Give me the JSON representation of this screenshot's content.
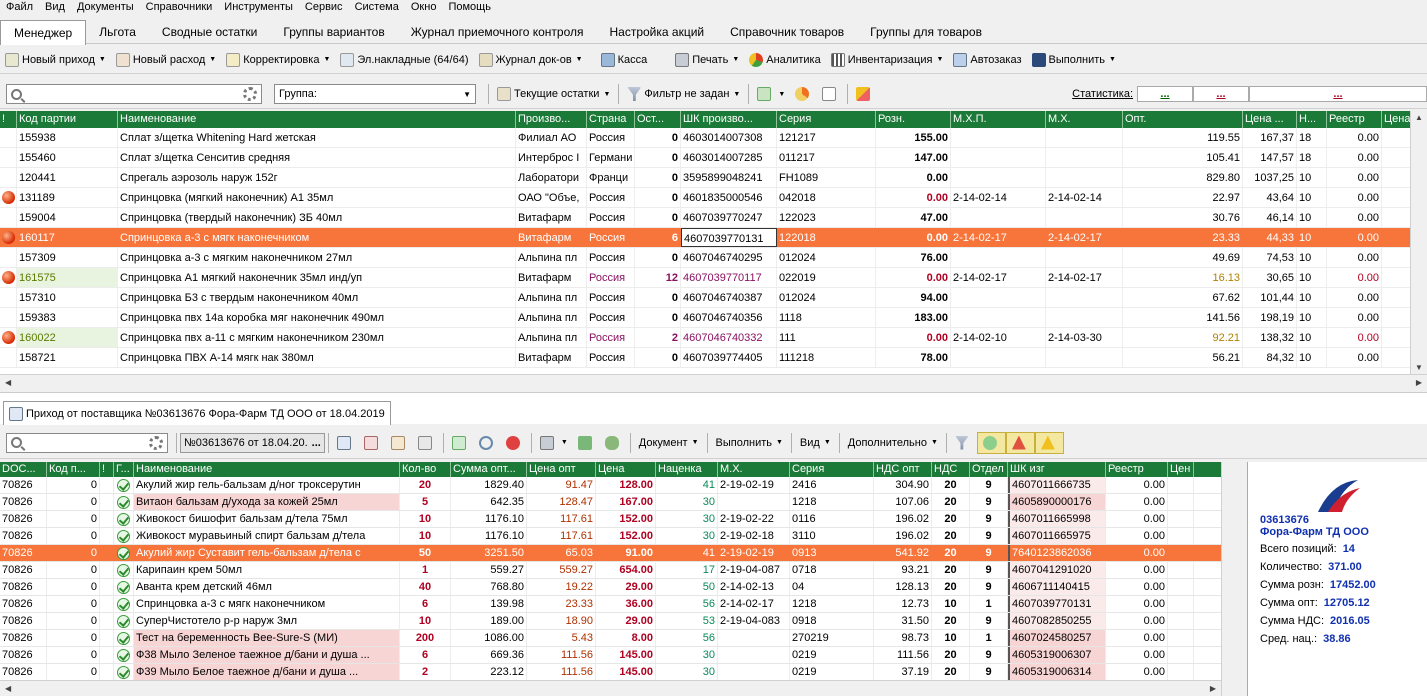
{
  "menu": [
    "Файл",
    "Вид",
    "Документы",
    "Справочники",
    "Инструменты",
    "Сервис",
    "Система",
    "Окно",
    "Помощь"
  ],
  "tabs": [
    "Менеджер",
    "Льгота",
    "Сводные остатки",
    "Группы вариантов",
    "Журнал приемочного контроля",
    "Настройка акций",
    "Справочник товаров",
    "Группы для товаров"
  ],
  "toolbar1": {
    "new_income": "Новый приход",
    "new_expense": "Новый расход",
    "correction": "Корректировка",
    "einvoices": "Эл.накладные (64/64)",
    "doc_journal": "Журнал док-ов",
    "cash": "Касса",
    "print": "Печать",
    "analytics": "Аналитика",
    "inventory": "Инвентаризация",
    "autoorder": "Автозаказ",
    "execute": "Выполнить"
  },
  "toolbar2": {
    "group_placeholder": "Группа:",
    "current_stock": "Текущие остатки",
    "filter": "Фильтр не задан",
    "stats_label": "Статистика:",
    "stat1": "...",
    "stat2": "...",
    "stat3": "..."
  },
  "top_grid": {
    "headers": [
      "!",
      "Код партии",
      "Наименование",
      "Произво...",
      "Страна",
      "Ост...",
      "ШК произво...",
      "Серия",
      "Розн.",
      "М.Х.П.",
      "М.Х.",
      "Опт.",
      "Цена ...",
      "Н...",
      "Реестр",
      "Цена изг"
    ],
    "rows": [
      {
        "flag": "",
        "code": "155938",
        "name": "Сплат з/щетка Whitening Hard жетская",
        "mfr": "Филиал АО",
        "country": "Россия",
        "stock": "0",
        "barcode": "4603014007308",
        "series": "121217",
        "retail": "155.00",
        "mhp": "",
        "mh": "",
        "opt": "119.55",
        "price": "167,37",
        "n": "18",
        "reg": "0.00",
        "pmfr": "119"
      },
      {
        "flag": "",
        "code": "155460",
        "name": "Сплат з/щетка Сенситив средняя",
        "mfr": "Интерброс I",
        "country": "Германи",
        "stock": "0",
        "barcode": "4603014007285",
        "series": "011217",
        "retail": "147.00",
        "mhp": "",
        "mh": "",
        "opt": "105.41",
        "price": "147,57",
        "n": "18",
        "reg": "0.00",
        "pmfr": "105"
      },
      {
        "flag": "",
        "code": "120441",
        "name": "Спрегаль аэрозоль наруж 152г",
        "mfr": "Лаборатори",
        "country": "Франци",
        "stock": "0",
        "barcode": "3595899048241",
        "series": "FH1089",
        "retail": "0.00",
        "mhp": "",
        "mh": "",
        "opt": "829.80",
        "price": "1037,25",
        "n": "10",
        "reg": "0.00",
        "pmfr": "754"
      },
      {
        "flag": "dot",
        "code": "131189",
        "name": "Спринцовка (мягкий наконечник) А1 35мл",
        "mfr": "ОАО \"Объе,",
        "country": "Россия",
        "stock": "0",
        "barcode": "4601835000546",
        "series": "042018",
        "retail": "0.00",
        "mhp": "2-14-02-14",
        "mh": "2-14-02-14",
        "opt": "22.97",
        "price": "43,64",
        "n": "10",
        "reg": "0.00",
        "pmfr": "20"
      },
      {
        "flag": "",
        "code": "159004",
        "name": "Спринцовка (твердый наконечник) ЗБ 40мл",
        "mfr": "Витафарм",
        "country": "Россия",
        "stock": "0",
        "barcode": "4607039770247",
        "series": "122023",
        "retail": "47.00",
        "mhp": "",
        "mh": "",
        "opt": "30.76",
        "price": "46,14",
        "n": "10",
        "reg": "0.00",
        "pmfr": "28"
      },
      {
        "flag": "dot",
        "code": "160117",
        "name": "Спринцовка а-3 с мягк наконечником",
        "mfr": "Витафарм",
        "country": "Россия",
        "stock": "6",
        "barcode": "4607039770131",
        "series": "122018",
        "retail": "0.00",
        "mhp": "2-14-02-17",
        "mh": "2-14-02-17",
        "opt": "23.33",
        "price": "44,33",
        "n": "10",
        "reg": "0.00",
        "pmfr": "23",
        "sel": true
      },
      {
        "flag": "",
        "code": "157309",
        "name": "Спринцовка а-3 с мягким наконечником 27мл",
        "mfr": "Альпина пл",
        "country": "Россия",
        "stock": "0",
        "barcode": "4607046740295",
        "series": "012024",
        "retail": "76.00",
        "mhp": "",
        "mh": "",
        "opt": "49.69",
        "price": "74,53",
        "n": "10",
        "reg": "0.00",
        "pmfr": "49"
      },
      {
        "flag": "dot",
        "code": "161575",
        "name": "Спринцовка А1 мягкий наконечник 35мл инд/уп",
        "mfr": "Витафарм",
        "country": "Россия",
        "stock": "12",
        "barcode": "4607039770117",
        "series": "022019",
        "retail": "0.00",
        "mhp": "2-14-02-17",
        "mh": "2-14-02-17",
        "opt": "16.13",
        "price": "30,65",
        "n": "10",
        "reg": "0.00",
        "pmfr": "15",
        "hl": true
      },
      {
        "flag": "",
        "code": "157310",
        "name": "Спринцовка Б3 с твердым наконечником 40мл",
        "mfr": "Альпина пл",
        "country": "Россия",
        "stock": "0",
        "barcode": "4607046740387",
        "series": "012024",
        "retail": "94.00",
        "mhp": "",
        "mh": "",
        "opt": "67.62",
        "price": "101,44",
        "n": "10",
        "reg": "0.00",
        "pmfr": "67"
      },
      {
        "flag": "",
        "code": "159383",
        "name": "Спринцовка пвх 14а коробка мяг наконечник 490мл",
        "mfr": "Альпина пл",
        "country": "Россия",
        "stock": "0",
        "barcode": "4607046740356",
        "series": "1118",
        "retail": "183.00",
        "mhp": "",
        "mh": "",
        "opt": "141.56",
        "price": "198,19",
        "n": "10",
        "reg": "0.00",
        "pmfr": "141"
      },
      {
        "flag": "dot",
        "code": "160022",
        "name": "Спринцовка пвх а-11 с мягким наконечником 230мл",
        "mfr": "Альпина пл",
        "country": "Россия",
        "stock": "2",
        "barcode": "4607046740332",
        "series": "111",
        "retail": "0.00",
        "mhp": "2-14-02-10",
        "mh": "2-14-03-30",
        "opt": "92.21",
        "price": "138,32",
        "n": "10",
        "reg": "0.00",
        "pmfr": "0",
        "hl": true
      },
      {
        "flag": "",
        "code": "158721",
        "name": "Спринцовка ПВХ А-14 мягк нак 380мл",
        "mfr": "Витафарм",
        "country": "Россия",
        "stock": "0",
        "barcode": "4607039774405",
        "series": "111218",
        "retail": "78.00",
        "mhp": "",
        "mh": "",
        "opt": "56.21",
        "price": "84,32",
        "n": "10",
        "reg": "0.00",
        "pmfr": "56"
      }
    ]
  },
  "doc_tab": "Приход от поставщика №03613676 Фора-Фарм ТД ООО от 18.04.2019",
  "toolbar3": {
    "doc_number": "№03613676 от 18.04.20.",
    "ellipsis": "...",
    "document": "Документ",
    "execute": "Выполнить",
    "view": "Вид",
    "extra": "Дополнительно"
  },
  "bottom_grid": {
    "headers": [
      "DOC...",
      "Код п...",
      "!",
      "Г...",
      "Наименование",
      "Кол-во",
      "Сумма опт...",
      "Цена опт",
      "Цена",
      "Наценка",
      "М.Х.",
      "Серия",
      "НДС опт",
      "НДС",
      "Отдел",
      "ШК изг",
      "Реестр",
      "Цен"
    ],
    "rows": [
      {
        "doc": "70826",
        "code": "0",
        "name": "Акулий жир гель-бальзам д/ног троксерутин",
        "qty": "20",
        "sum": "1829.40",
        "popt": "91.47",
        "price": "128.00",
        "markup": "41",
        "mh": "2-19-02-19",
        "series": "2416",
        "nds_opt": "304.90",
        "nds": "20",
        "dept": "9",
        "bc": "4607011666735",
        "reg": "0.00"
      },
      {
        "doc": "70826",
        "code": "0",
        "name": "Витаон бальзам д/ухода за кожей 25мл",
        "qty": "5",
        "sum": "642.35",
        "popt": "128.47",
        "price": "167.00",
        "markup": "30",
        "mh": "",
        "series": "1218",
        "nds_opt": "107.06",
        "nds": "20",
        "dept": "9",
        "bc": "4605890000176",
        "reg": "0.00",
        "pink": true
      },
      {
        "doc": "70826",
        "code": "0",
        "name": "Живокост бишофит бальзам д/тела 75мл",
        "qty": "10",
        "sum": "1176.10",
        "popt": "117.61",
        "price": "152.00",
        "markup": "30",
        "mh": "2-19-02-22",
        "series": "0116",
        "nds_opt": "196.02",
        "nds": "20",
        "dept": "9",
        "bc": "4607011665998",
        "reg": "0.00"
      },
      {
        "doc": "70826",
        "code": "0",
        "name": "Живокост муравьиный спирт бальзам д/тела",
        "qty": "10",
        "sum": "1176.10",
        "popt": "117.61",
        "price": "152.00",
        "markup": "30",
        "mh": "2-19-02-18",
        "series": "3110",
        "nds_opt": "196.02",
        "nds": "20",
        "dept": "9",
        "bc": "4607011665975",
        "reg": "0.00"
      },
      {
        "doc": "70826",
        "code": "0",
        "name": "Акулий жир Суставит гель-бальзам д/тела с",
        "qty": "50",
        "sum": "3251.50",
        "popt": "65.03",
        "price": "91.00",
        "markup": "41",
        "mh": "2-19-02-19",
        "series": "0913",
        "nds_opt": "541.92",
        "nds": "20",
        "dept": "9",
        "bc": "7640123862036",
        "reg": "0.00",
        "sel": true
      },
      {
        "doc": "70826",
        "code": "0",
        "name": "Карипаин крем 50мл",
        "qty": "1",
        "sum": "559.27",
        "popt": "559.27",
        "price": "654.00",
        "markup": "17",
        "mh": "2-19-04-087",
        "series": "0718",
        "nds_opt": "93.21",
        "nds": "20",
        "dept": "9",
        "bc": "4607041291020",
        "reg": "0.00"
      },
      {
        "doc": "70826",
        "code": "0",
        "name": "Аванта крем детский 46мл",
        "qty": "40",
        "sum": "768.80",
        "popt": "19.22",
        "price": "29.00",
        "markup": "50",
        "mh": "2-14-02-13",
        "series": "04",
        "nds_opt": "128.13",
        "nds": "20",
        "dept": "9",
        "bc": "4606711140415",
        "reg": "0.00"
      },
      {
        "doc": "70826",
        "code": "0",
        "name": "Спринцовка а-3 с мягк наконечником",
        "qty": "6",
        "sum": "139.98",
        "popt": "23.33",
        "price": "36.00",
        "markup": "56",
        "mh": "2-14-02-17",
        "series": "1218",
        "nds_opt": "12.73",
        "nds": "10",
        "dept": "1",
        "bc": "4607039770131",
        "reg": "0.00"
      },
      {
        "doc": "70826",
        "code": "0",
        "name": "СуперЧистотело р-р наруж 3мл",
        "qty": "10",
        "sum": "189.00",
        "popt": "18.90",
        "price": "29.00",
        "markup": "53",
        "mh": "2-19-04-083",
        "series": "0918",
        "nds_opt": "31.50",
        "nds": "20",
        "dept": "9",
        "bc": "4607082850255",
        "reg": "0.00"
      },
      {
        "doc": "70826",
        "code": "0",
        "name": "Тест на беременность Bee-Sure-S (МИ)",
        "qty": "200",
        "sum": "1086.00",
        "popt": "5.43",
        "price": "8.00",
        "markup": "56",
        "mh": "",
        "series": "270219",
        "nds_opt": "98.73",
        "nds": "10",
        "dept": "1",
        "bc": "4607024580257",
        "reg": "0.00",
        "pink": true
      },
      {
        "doc": "70826",
        "code": "0",
        "name": "Ф38 Мыло Зеленое таежное д/бани и душа ...",
        "qty": "6",
        "sum": "669.36",
        "popt": "111.56",
        "price": "145.00",
        "markup": "30",
        "mh": "",
        "series": "0219",
        "nds_opt": "111.56",
        "nds": "20",
        "dept": "9",
        "bc": "4605319006307",
        "reg": "0.00",
        "pink": true
      },
      {
        "doc": "70826",
        "code": "0",
        "name": "Ф39 Мыло Белое таежное д/бани и душа ...",
        "qty": "2",
        "sum": "223.12",
        "popt": "111.56",
        "price": "145.00",
        "markup": "30",
        "mh": "",
        "series": "0219",
        "nds_opt": "37.19",
        "nds": "20",
        "dept": "9",
        "bc": "4605319006314",
        "reg": "0.00",
        "pink": true
      }
    ]
  },
  "info": {
    "doc_no": "03613676",
    "supplier": "Фора-Фарм ТД ООО",
    "positions_label": "Всего позиций:",
    "positions": "14",
    "qty_label": "Количество:",
    "qty": "371.00",
    "retail_label": "Сумма розн:",
    "retail": "17452.00",
    "opt_label": "Сумма опт:",
    "opt": "12705.12",
    "nds_label": "Сумма НДС:",
    "nds": "2016.05",
    "markup_label": "Сред. нац.:",
    "markup": "38.86"
  },
  "colors": {
    "header_green": "#1b7a37",
    "selection": "#f7743a",
    "pink": "#f8d5d5",
    "info_blue": "#1030b0"
  }
}
